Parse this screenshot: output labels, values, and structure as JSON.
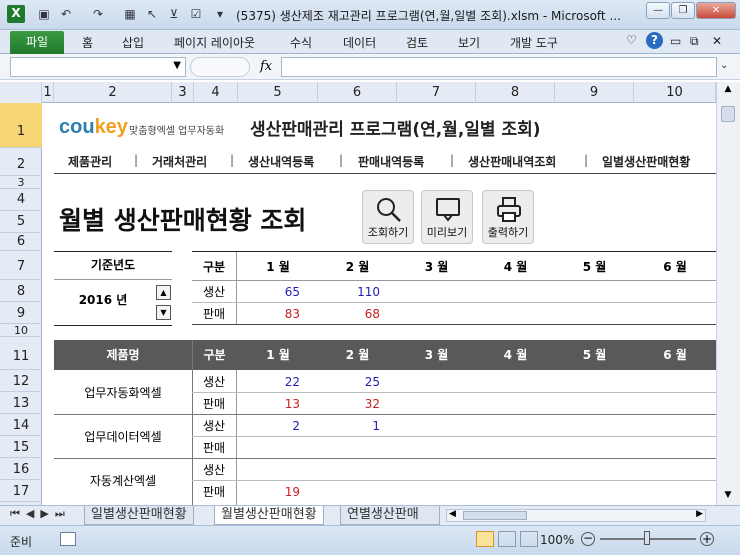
{
  "window": {
    "title": "(5375) 생산제조 재고관리 프로그램(연,월,일별 조회).xlsm  -  Microsoft ..."
  },
  "ribbon": {
    "tabs": [
      "파일",
      "홈",
      "삽입",
      "페이지 레이아웃",
      "수식",
      "데이터",
      "검토",
      "보기",
      "개발 도구"
    ]
  },
  "columns": [
    "1",
    "2",
    "3",
    "4",
    "5",
    "6",
    "7",
    "8",
    "9",
    "10"
  ],
  "rows": [
    "1",
    "2",
    "3",
    "4",
    "5",
    "6",
    "7",
    "8",
    "9",
    "10",
    "11",
    "12",
    "13",
    "14",
    "15",
    "16",
    "17"
  ],
  "header": {
    "logo_main": "cou",
    "logo_accent": "key",
    "tagline": "맞춤형엑셀 업무자동화",
    "app_title": "생산판매관리 프로그램(연,월,일별 조회)"
  },
  "nav": [
    "제품관리",
    "거래처관리",
    "생산내역등록",
    "판매내역등록",
    "생산판매내역조회",
    "일별생산판매현황"
  ],
  "page_title": "월별 생산판매현황 조회",
  "buttons": {
    "search": "조회하기",
    "preview": "미리보기",
    "print": "출력하기"
  },
  "year_box": {
    "label": "기준년도",
    "value": "2016 년"
  },
  "summary": {
    "type_header": "구분",
    "months": [
      "1 월",
      "2 월",
      "3 월",
      "4 월",
      "5 월",
      "6 월"
    ],
    "production_label": "생산",
    "sales_label": "판매",
    "production": [
      "65",
      "110",
      "",
      "",
      "",
      ""
    ],
    "sales": [
      "83",
      "68",
      "",
      "",
      "",
      ""
    ]
  },
  "detail": {
    "product_header": "제품명",
    "type_header": "구분",
    "months": [
      "1 월",
      "2 월",
      "3 월",
      "4 월",
      "5 월",
      "6 월"
    ],
    "products": [
      {
        "name": "업무자동화엑셀",
        "production": [
          "22",
          "25",
          "",
          "",
          "",
          ""
        ],
        "sales": [
          "13",
          "32",
          "",
          "",
          "",
          ""
        ]
      },
      {
        "name": "업무데이터엑셀",
        "production": [
          "2",
          "1",
          "",
          "",
          "",
          ""
        ],
        "sales": [
          "",
          "",
          "",
          "",
          "",
          ""
        ]
      },
      {
        "name": "자동계산엑셀",
        "production": [
          "",
          "",
          "",
          "",
          "",
          ""
        ],
        "sales": [
          "19",
          "",
          "",
          "",
          "",
          ""
        ]
      }
    ],
    "production_label": "생산",
    "sales_label": "판매"
  },
  "sheet_tabs": [
    "일별생산판매현황",
    "월별생산판매현황",
    "연별생산판매"
  ],
  "status": {
    "ready": "준비",
    "zoom": "100%"
  },
  "colors": {
    "excel_green": "#1f7a2b",
    "header_dark": "#595959",
    "production_blue": "#1f1fb5",
    "sales_red": "#c81e1e"
  }
}
